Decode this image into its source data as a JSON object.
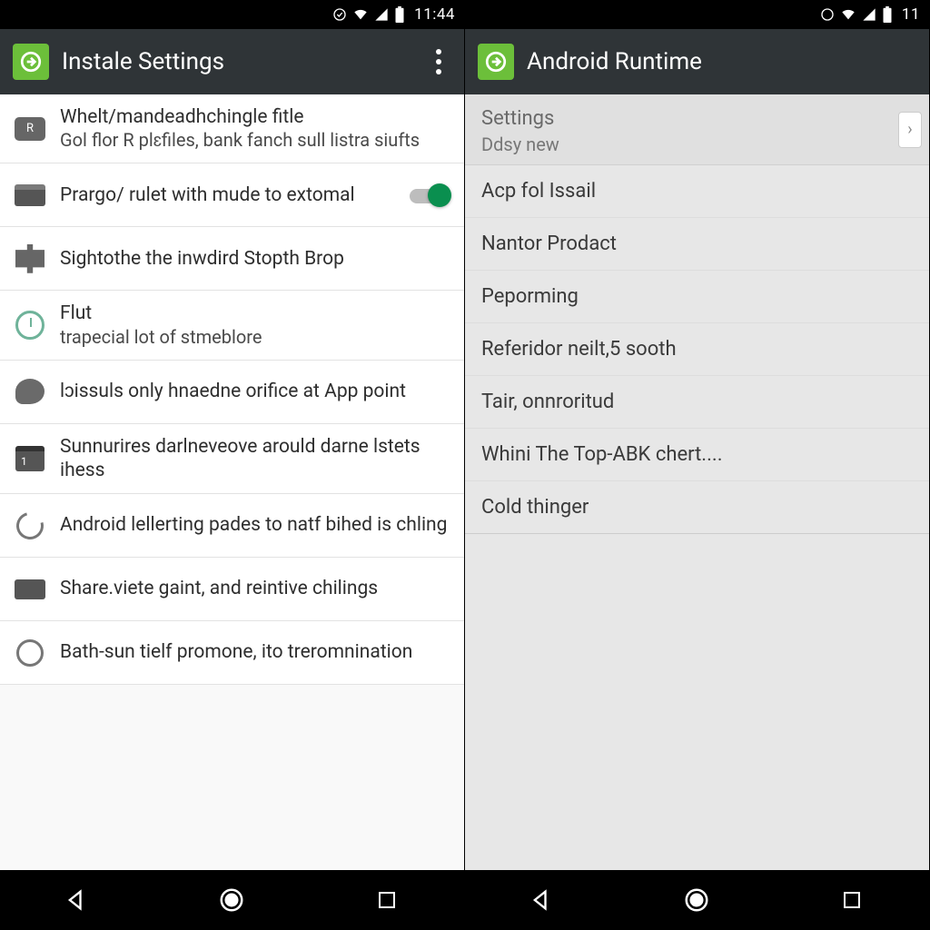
{
  "left": {
    "status": {
      "time": "11:44"
    },
    "actionbar": {
      "title": "Instale Settings"
    },
    "items": [
      {
        "icon": "badge-icon",
        "primary": "Whelt/mandeadhchingle fitle",
        "secondary": "Gol flor R plɛfiles, bank fanch sull listra siufts",
        "toggle": null
      },
      {
        "icon": "wallet-icon",
        "primary": "Prargo/ rulet with mude to extomal",
        "secondary": "",
        "toggle": true
      },
      {
        "icon": "puzzle-icon",
        "primary": "Sightothe the inwdird Stopth Brop",
        "secondary": "",
        "toggle": null
      },
      {
        "icon": "clock-icon",
        "primary": "Flut",
        "secondary": "trapecial lot of stmeblore",
        "toggle": null
      },
      {
        "icon": "chat-icon",
        "primary": "lɔissuls only hnaedne orifice at App point",
        "secondary": "",
        "toggle": null
      },
      {
        "icon": "calendar-icon",
        "primary": "Sunnurires darlneveove arould darne lstets ihess",
        "secondary": "",
        "toggle": null
      },
      {
        "icon": "refresh-icon",
        "primary": "Android lellerting pades to natf bihed is chling",
        "secondary": "",
        "toggle": null
      },
      {
        "icon": "share-icon",
        "primary": "Share.viete gaint, and reintive chilings",
        "secondary": "",
        "toggle": null
      },
      {
        "icon": "back-icon",
        "primary": "Bath-sun tielf promone, ito treromnination",
        "secondary": "",
        "toggle": null
      }
    ]
  },
  "right": {
    "status": {
      "time": "11"
    },
    "actionbar": {
      "title": "Android Runtime"
    },
    "section": {
      "title": "Settings",
      "subtitle": "Ddsy new"
    },
    "items": [
      "Acp fol Issail",
      "Nantor Prodact",
      "Peporming",
      "Referidor neilt,5 sooth",
      "Tair, onnroritud",
      "Whini The Top-ABK chert....",
      "Cold thinger"
    ]
  }
}
